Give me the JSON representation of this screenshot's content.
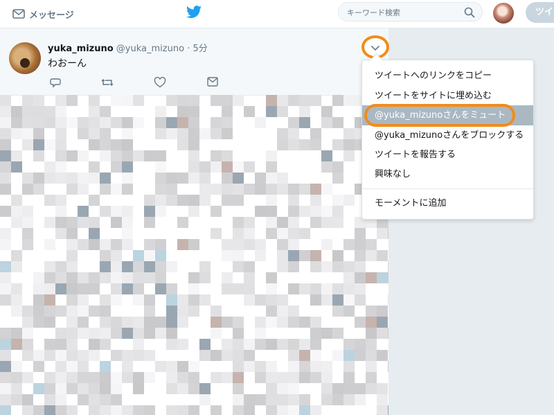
{
  "header": {
    "messages_label": "メッセージ",
    "search_placeholder": "キーワード検索",
    "tweet_button_label": "ツイ"
  },
  "tweet": {
    "name": "yuka_mizuno",
    "handle": "@yuka_mizuno",
    "separator": "·",
    "time": "5分",
    "text": "わおーん"
  },
  "menu": {
    "items": [
      "ツイートへのリンクをコピー",
      "ツイートをサイトに埋め込む",
      "@yuka_mizunoさんをミュート",
      "@yuka_mizunoさんをブロックする",
      "ツイートを報告する",
      "興味なし",
      "モーメントに追加"
    ],
    "highlighted_index": 2
  },
  "colors": {
    "highlight_ring": "#f28c18",
    "menu_hover": "#aab8c2",
    "twitter_blue": "#1da1f2",
    "background": "#e6ecf0"
  },
  "icons": [
    "mail-icon",
    "twitter-bird-icon",
    "search-icon",
    "reply-icon",
    "retweet-icon",
    "like-icon",
    "dm-icon",
    "chevron-down-icon"
  ]
}
